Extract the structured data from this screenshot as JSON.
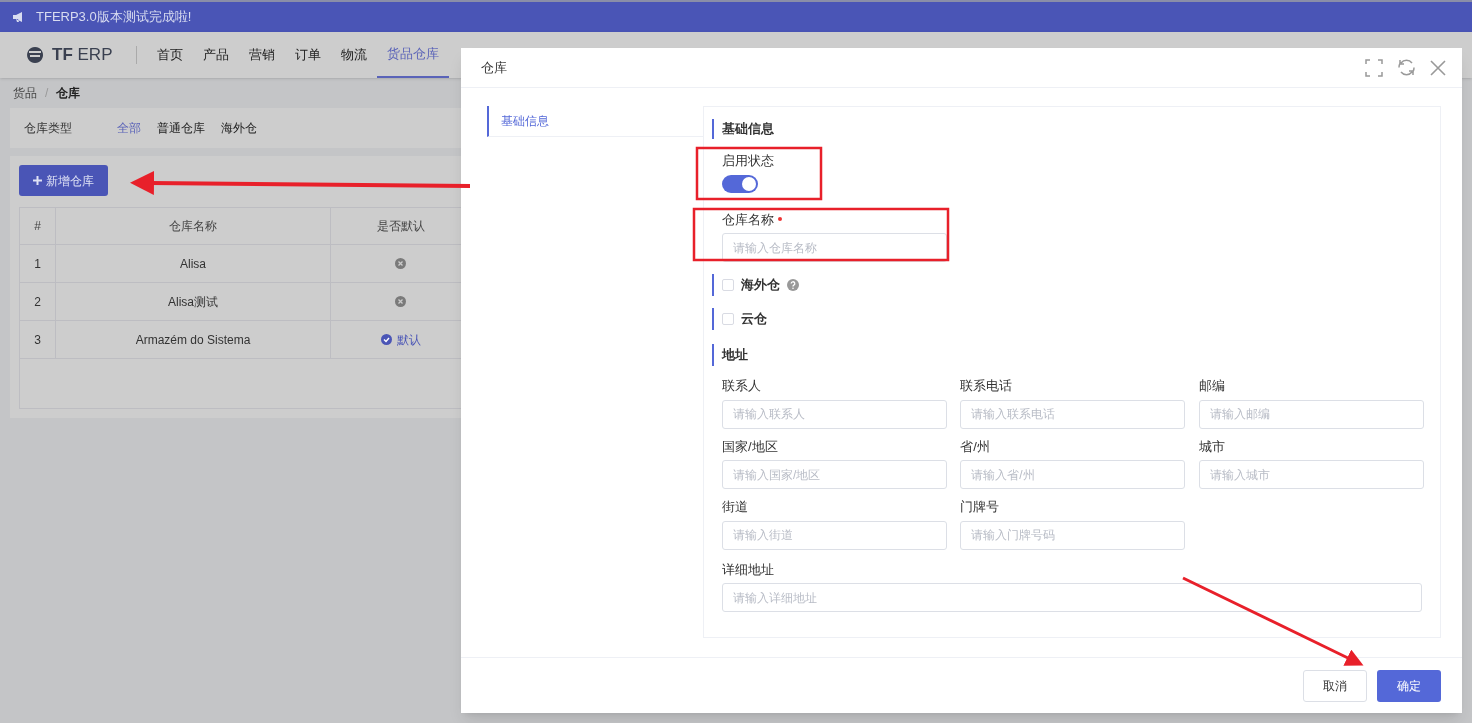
{
  "banner": {
    "text": "TFERP3.0版本测试完成啦!"
  },
  "nav": {
    "logo_bold": "TF",
    "logo_light": "ERP",
    "items": [
      {
        "label": "首页",
        "selected": false
      },
      {
        "label": "产品",
        "selected": false
      },
      {
        "label": "营销",
        "selected": false
      },
      {
        "label": "订单",
        "selected": false
      },
      {
        "label": "物流",
        "selected": false
      },
      {
        "label": "货品仓库",
        "selected": true
      }
    ]
  },
  "breadcrumb": [
    "货品",
    "仓库"
  ],
  "breadcrumb_separator": "/",
  "filter": {
    "label": "仓库类型",
    "options": [
      {
        "label": "全部",
        "selected": true
      },
      {
        "label": "普通仓库",
        "selected": false
      },
      {
        "label": "海外仓",
        "selected": false
      }
    ]
  },
  "add_button": {
    "label": "新增仓库"
  },
  "table": {
    "columns": [
      "#",
      "仓库名称",
      "是否默认"
    ],
    "rows": [
      {
        "index": "1",
        "name": "Alisa",
        "is_default": false
      },
      {
        "index": "2",
        "name": "Alisa测试",
        "is_default": false
      },
      {
        "index": "3",
        "name": "Armazém do Sistema",
        "is_default": true,
        "default_label": "默认"
      }
    ]
  },
  "modal": {
    "title": "仓库",
    "side_tabs": [
      {
        "label": "基础信息",
        "selected": true
      }
    ],
    "section_title": "基础信息",
    "enable_status": {
      "label": "启用状态",
      "on": true
    },
    "name_field": {
      "label": "仓库名称",
      "required": true,
      "placeholder": "请输入仓库名称"
    },
    "checkboxes": [
      {
        "label": "海外仓",
        "checked": false,
        "help": true
      },
      {
        "label": "云仓",
        "checked": false,
        "help": false
      }
    ],
    "address_title": "地址",
    "address_fields": [
      {
        "label": "联系人",
        "placeholder": "请输入联系人"
      },
      {
        "label": "联系电话",
        "placeholder": "请输入联系电话"
      },
      {
        "label": "邮编",
        "placeholder": "请输入邮编"
      },
      {
        "label": "国家/地区",
        "placeholder": "请输入国家/地区"
      },
      {
        "label": "省/州",
        "placeholder": "请输入省/州"
      },
      {
        "label": "城市",
        "placeholder": "请输入城市"
      },
      {
        "label": "街道",
        "placeholder": "请输入街道"
      },
      {
        "label": "门牌号",
        "placeholder": "请输入门牌号码"
      }
    ],
    "detail_field": {
      "label": "详细地址",
      "placeholder": "请输入详细地址"
    },
    "buttons": {
      "cancel": "取消",
      "confirm": "确定"
    }
  }
}
